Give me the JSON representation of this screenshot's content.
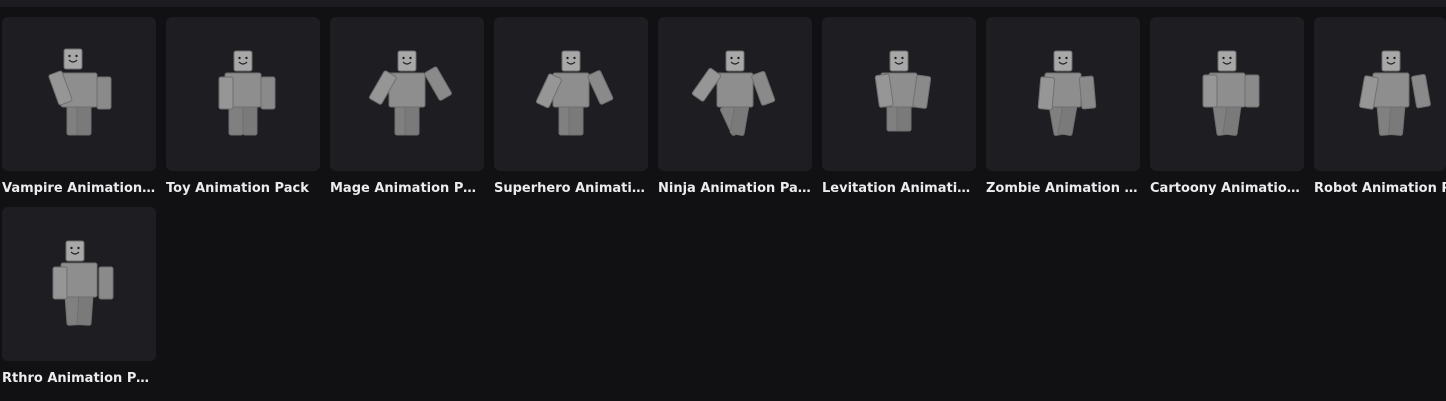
{
  "items": [
    {
      "title": "Vampire Animation ...",
      "thumbnail": "avatar-vampire-pose-icon",
      "pose": "vampire"
    },
    {
      "title": "Toy Animation Pack",
      "thumbnail": "avatar-toy-pose-icon",
      "pose": "toy"
    },
    {
      "title": "Mage Animation Pac...",
      "thumbnail": "avatar-mage-pose-icon",
      "pose": "mage"
    },
    {
      "title": "Superhero Animatio...",
      "thumbnail": "avatar-superhero-pose-icon",
      "pose": "superhero"
    },
    {
      "title": "Ninja Animation Pac...",
      "thumbnail": "avatar-ninja-pose-icon",
      "pose": "ninja"
    },
    {
      "title": "Levitation Animatio...",
      "thumbnail": "avatar-levitation-pose-icon",
      "pose": "levitation"
    },
    {
      "title": "Zombie Animation P...",
      "thumbnail": "avatar-zombie-pose-icon",
      "pose": "zombie"
    },
    {
      "title": "Cartoony Animation ...",
      "thumbnail": "avatar-cartoony-pose-icon",
      "pose": "cartoony"
    },
    {
      "title": "Robot Animation Pa",
      "thumbnail": "avatar-robot-pose-icon",
      "pose": "robot"
    },
    {
      "title": "Rthro Animation Pac...",
      "thumbnail": "avatar-rthro-pose-icon",
      "pose": "rthro"
    }
  ],
  "colors": {
    "background": "#111114",
    "card": "#1d1d22",
    "text": "#ececee",
    "avatar": "#8e8e8e"
  }
}
